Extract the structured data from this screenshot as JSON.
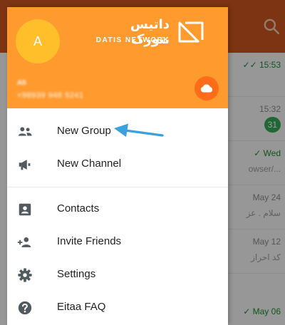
{
  "background": {
    "chats": [
      {
        "time": "15:53",
        "read": true,
        "snippet": ""
      },
      {
        "time": "15:32",
        "read": false,
        "snippet": "",
        "unread": "31"
      },
      {
        "time": "Wed",
        "read": true,
        "snippet": "owser/..."
      },
      {
        "time": "May 24",
        "read": false,
        "snippet": "سلام . عز"
      },
      {
        "time": "May 12",
        "read": false,
        "snippet": "کد احراز"
      },
      {
        "time": "May 06",
        "read": true,
        "snippet": ""
      }
    ]
  },
  "drawer": {
    "avatar_letter": "A",
    "brand": {
      "name_fa": "داتیس نتورک",
      "name_en": "DATIS NETWORK"
    },
    "user": {
      "name": "Ali",
      "phone": "+98939 948 5241"
    },
    "menu": [
      {
        "label": "New Group",
        "icon": "new-group-icon"
      },
      {
        "label": "New Channel",
        "icon": "megaphone-icon"
      },
      {
        "label": "Contacts",
        "icon": "contacts-icon"
      },
      {
        "label": "Invite Friends",
        "icon": "add-person-icon"
      },
      {
        "label": "Settings",
        "icon": "gear-icon"
      },
      {
        "label": "Eitaa FAQ",
        "icon": "help-icon"
      }
    ]
  },
  "colors": {
    "header": "#ff9a2e",
    "avatar": "#ffbf2b",
    "cloud_button": "#ff6d1a",
    "toolbar": "#c9551f",
    "icon": "#505a5f",
    "arrow": "#3aa0de"
  }
}
